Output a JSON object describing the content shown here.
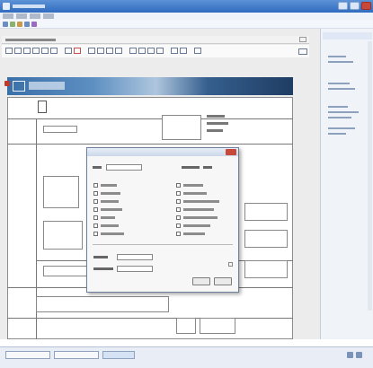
{
  "window": {
    "buttons": [
      "minimize",
      "maximize",
      "close"
    ]
  },
  "menubar": {
    "item_count": 4
  },
  "statusbar": {
    "tasks": []
  },
  "colors": {
    "title_bar": "#2f6bbf",
    "banner": "#3b6fa8",
    "close_button": "#c8483a",
    "panel": "#f0f4f9",
    "dialog": "#f7f7f7"
  },
  "dialog": {
    "left_options_count": 7,
    "right_options_count": 7,
    "ok_label": "",
    "cancel_label": ""
  }
}
